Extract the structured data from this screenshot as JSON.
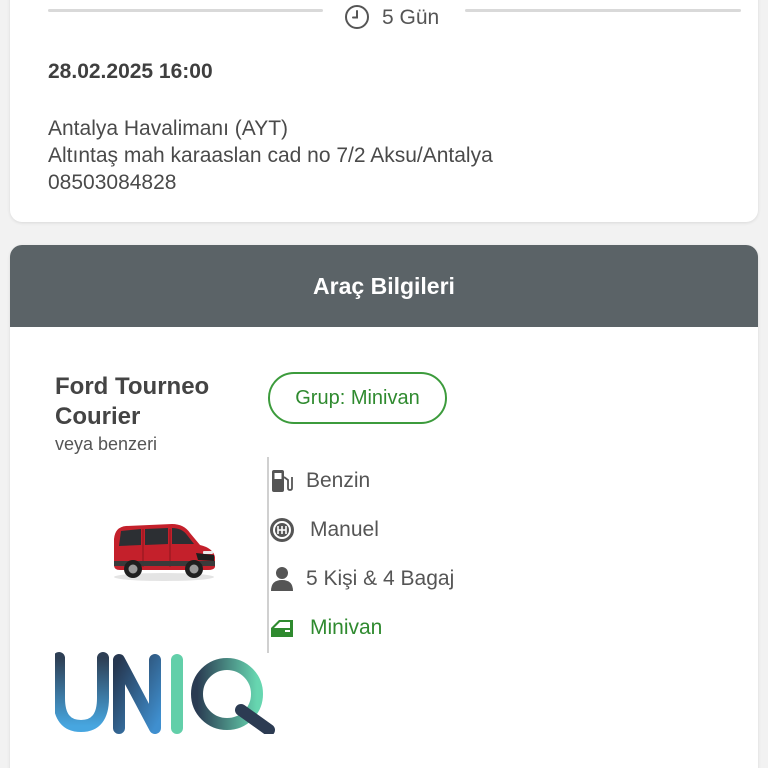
{
  "rental": {
    "duration": "5 Gün",
    "pickup_datetime": "28.02.2025 16:00",
    "location_name": "Antalya Havalimanı (AYT)",
    "location_address": "Altıntaş mah karaaslan cad no 7/2 Aksu/Antalya",
    "location_phone": "08503084828"
  },
  "vehicle": {
    "section_title": "Araç Bilgileri",
    "model_name": "Ford Tourneo Courier",
    "model_note": "veya benzeri",
    "group_badge": "Grup: Minivan",
    "specs": {
      "fuel": "Benzin",
      "transmission": "Manuel",
      "capacity": "5 Kişi & 4 Bagaj",
      "body_type": "Minivan"
    },
    "car_color": "#c4202b"
  },
  "brand": {
    "logo_text": "UNIQ"
  },
  "colors": {
    "header_bg": "#5b6367",
    "accent_green": "#2f8a2f",
    "text_dark": "#444444"
  },
  "icons": {
    "duration": "clock-icon",
    "fuel": "fuel-pump-icon",
    "transmission": "gearbox-icon",
    "capacity": "person-icon",
    "body_type": "car-door-icon"
  }
}
